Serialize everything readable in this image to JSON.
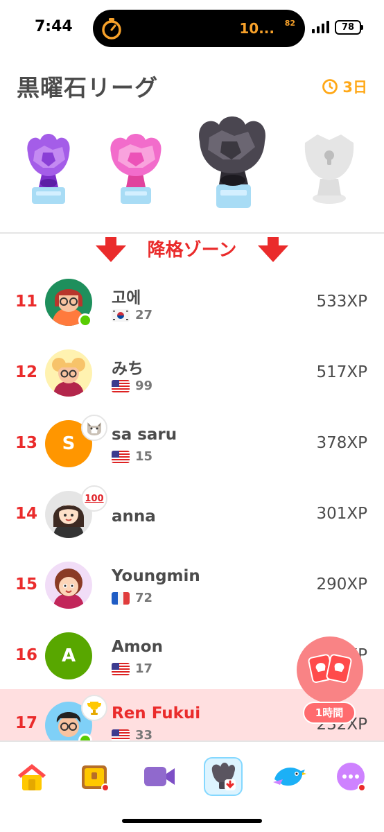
{
  "status_bar": {
    "time": "7:44",
    "timer_text": "10...",
    "timer_sup": "82",
    "battery": "78"
  },
  "header": {
    "title": "黒曜石リーグ",
    "countdown": "3日"
  },
  "trophies": [
    {
      "name": "amethyst-league-trophy",
      "color": "#a45de8"
    },
    {
      "name": "pearl-league-trophy",
      "color": "#f26ccb"
    },
    {
      "name": "obsidian-league-trophy",
      "color": "#5a5560",
      "current": true
    },
    {
      "name": "diamond-league-trophy",
      "color": "#d9d9d9",
      "locked": true
    }
  ],
  "zone": {
    "label": "降格ゾーン"
  },
  "leaderboard": [
    {
      "rank": "11",
      "name": "고에",
      "flag": "kr",
      "streak": "27",
      "xp": "533XP",
      "online": true
    },
    {
      "rank": "12",
      "name": "みち",
      "flag": "us",
      "streak": "99",
      "xp": "517XP"
    },
    {
      "rank": "13",
      "name": "sa saru",
      "flag": "us",
      "streak": "15",
      "xp": "378XP",
      "avatar_letter": "S",
      "avatar_color": "#ff9600",
      "badge": "cat-icon"
    },
    {
      "rank": "14",
      "name": "anna",
      "xp": "301XP",
      "badge": "hundred-icon"
    },
    {
      "rank": "15",
      "name": "Youngmin",
      "flag": "fr",
      "streak": "72",
      "xp": "290XP"
    },
    {
      "rank": "16",
      "name": "Amon",
      "flag": "us",
      "streak": "17",
      "xp": "XP",
      "avatar_letter": "A",
      "avatar_color": "#58a700"
    },
    {
      "rank": "17",
      "name": "Ren Fukui",
      "flag": "us",
      "streak": "33",
      "xp": "232XP",
      "me": true,
      "online": true,
      "badge": "trophy-icon"
    }
  ],
  "fab": {
    "timer": "1時間"
  },
  "bottom_nav": [
    {
      "name": "home"
    },
    {
      "name": "quests",
      "dot": true
    },
    {
      "name": "video"
    },
    {
      "name": "leagues",
      "active": true
    },
    {
      "name": "practice"
    },
    {
      "name": "more",
      "dot": true
    }
  ],
  "colors": {
    "danger": "#ea2b2b",
    "highlight_row": "#ffdfe0",
    "accent_orange": "#ffa817",
    "nav_active": "#ddf4ff"
  }
}
